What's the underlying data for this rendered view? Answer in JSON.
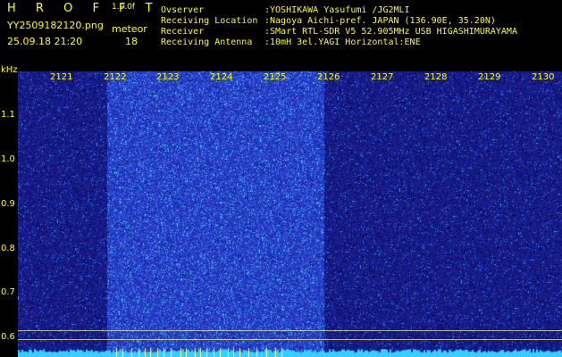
{
  "header": {
    "logo": "H R O F F T",
    "version": "1.0.0f",
    "filename": "YY2509182120.png",
    "datetime": "25.09.18 21:20",
    "meteor_label": "meteor",
    "meteor_count": "18",
    "info": [
      {
        "key": "Ovserver",
        "value": ":YOSHIKAWA Yasufumi /JG2MLI"
      },
      {
        "key": "Receiving Location",
        "value": ":Nagoya Aichi-pref. JAPAN (136.90E, 35.20N)"
      },
      {
        "key": "Receiver",
        "value": ":SMart RTL-SDR V5 52.905MHz USB HIGASHIMURAYAMA"
      },
      {
        "key": "Receiving Antenna",
        "value": ":10mH 3el.YAGI Horizontal:ENE"
      }
    ]
  },
  "axis": {
    "unit": "kHz",
    "y_ticks": [
      "1.1",
      "1.0",
      "0.9",
      "0.8",
      "0.7",
      "0.6"
    ],
    "x_ticks": [
      "2121",
      "2122",
      "2123",
      "2124",
      "2125",
      "2126",
      "2127",
      "2128",
      "2129",
      "2130"
    ]
  },
  "colors": {
    "text": "#ffff00",
    "background": "#000000",
    "noise": "#1a20a0",
    "meteor_band": "#2a3ad0",
    "floor": "#30d0ff"
  }
}
